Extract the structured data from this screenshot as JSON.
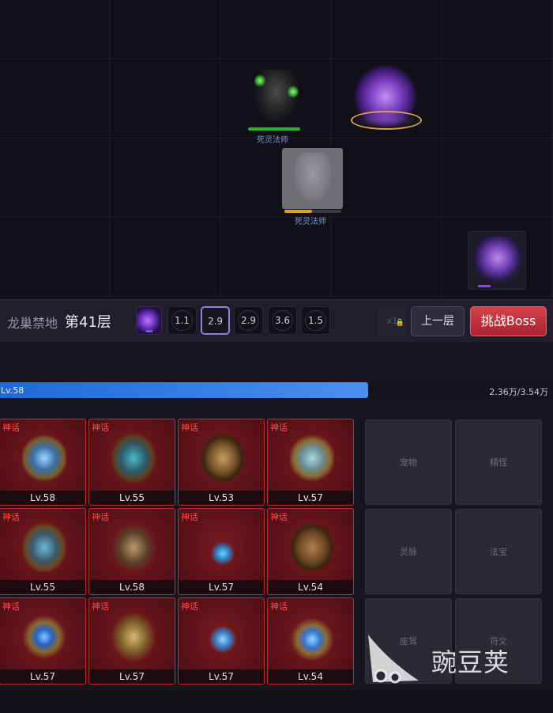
{
  "battle": {
    "units": [
      {
        "name": "死灵法师",
        "hp_fraction": 1.0,
        "hp_color": "#27b52a"
      },
      {
        "name": "死灵法师",
        "hp_fraction": 0.48,
        "hp_color": "#e2a21c"
      }
    ]
  },
  "control_bar": {
    "area_name": "龙巢禁地",
    "floor_label": "第41层",
    "speeds": [
      {
        "value": "1.1",
        "selected": false
      },
      {
        "value": "2.9",
        "selected": true
      },
      {
        "value": "2.9",
        "selected": false
      },
      {
        "value": "3.6",
        "selected": false
      },
      {
        "value": "1.5",
        "selected": false
      }
    ],
    "locked_multiplier": "x1",
    "prev_floor_label": "上一层",
    "boss_button_label": "挑战Boss"
  },
  "xp": {
    "level_label": "Lv.58",
    "progress_text": "2.36万/3.54万",
    "fraction": 0.666
  },
  "equipment": [
    {
      "rarity": "神话",
      "level": "Lv.58",
      "icon": "sword-shield-icon"
    },
    {
      "rarity": "神话",
      "level": "Lv.55",
      "icon": "helmet-icon"
    },
    {
      "rarity": "神话",
      "level": "Lv.53",
      "icon": "armor-icon"
    },
    {
      "rarity": "神话",
      "level": "Lv.57",
      "icon": "round-shield-icon"
    },
    {
      "rarity": "神话",
      "level": "Lv.55",
      "icon": "gauntlet-icon"
    },
    {
      "rarity": "神话",
      "level": "Lv.58",
      "icon": "belt-icon"
    },
    {
      "rarity": "神话",
      "level": "Lv.57",
      "icon": "necklace-icon"
    },
    {
      "rarity": "神话",
      "level": "Lv.54",
      "icon": "boots-icon"
    },
    {
      "rarity": "神话",
      "level": "Lv.57",
      "icon": "ring-icon"
    },
    {
      "rarity": "神话",
      "level": "Lv.57",
      "icon": "talisman-icon"
    },
    {
      "rarity": "神话",
      "level": "Lv.57",
      "icon": "earring-icon"
    },
    {
      "rarity": "神话",
      "level": "Lv.54",
      "icon": "amulet-icon"
    }
  ],
  "features": [
    {
      "label": "宠物"
    },
    {
      "label": "精怪"
    },
    {
      "label": "灵脉"
    },
    {
      "label": "法宝"
    },
    {
      "label": "座驾"
    },
    {
      "label": "符文"
    }
  ],
  "watermark": {
    "text": "豌豆荚"
  },
  "colors": {
    "mythic_red": "#ff4a4a",
    "boss_button": "#c8323e",
    "xp_blue": "#3a82ea",
    "selected_speed": "#9b7ae0"
  }
}
